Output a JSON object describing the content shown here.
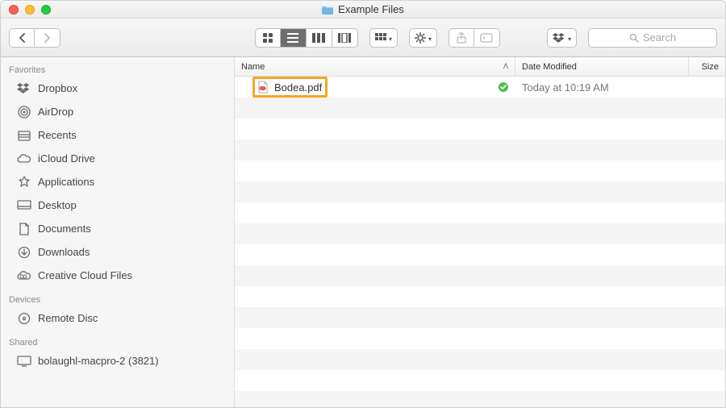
{
  "window": {
    "title": "Example Files"
  },
  "toolbar": {
    "search_placeholder": "Search"
  },
  "sidebar": {
    "sections": [
      {
        "name": "Favorites",
        "items": [
          {
            "icon": "dropbox",
            "label": "Dropbox"
          },
          {
            "icon": "airdrop",
            "label": "AirDrop"
          },
          {
            "icon": "recents",
            "label": "Recents"
          },
          {
            "icon": "icloud",
            "label": "iCloud Drive"
          },
          {
            "icon": "apps",
            "label": "Applications"
          },
          {
            "icon": "desktop",
            "label": "Desktop"
          },
          {
            "icon": "documents",
            "label": "Documents"
          },
          {
            "icon": "downloads",
            "label": "Downloads"
          },
          {
            "icon": "cc",
            "label": "Creative Cloud Files"
          }
        ]
      },
      {
        "name": "Devices",
        "items": [
          {
            "icon": "disc",
            "label": "Remote Disc"
          }
        ]
      },
      {
        "name": "Shared",
        "items": [
          {
            "icon": "host",
            "label": "bolaughl-macpro-2 (3821)"
          }
        ]
      }
    ]
  },
  "columns": {
    "name": "Name",
    "date": "Date Modified",
    "size": "Size"
  },
  "files": [
    {
      "name": "Bodea.pdf",
      "date": "Today at 10:19 AM",
      "size": "",
      "synced": true,
      "highlighted": true
    }
  ]
}
